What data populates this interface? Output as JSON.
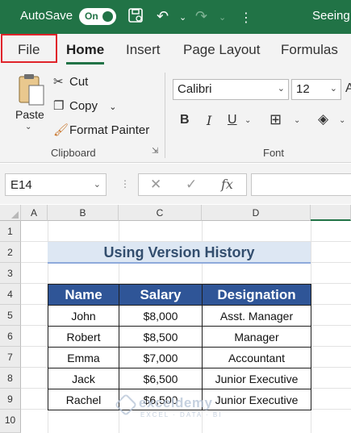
{
  "titlebar": {
    "autosave_label": "AutoSave",
    "autosave_state": "On",
    "document": "Seeing"
  },
  "tabs": [
    "File",
    "Home",
    "Insert",
    "Page Layout",
    "Formulas"
  ],
  "ribbon": {
    "clipboard": {
      "paste": "Paste",
      "cut": "Cut",
      "copy": "Copy",
      "format_painter": "Format Painter",
      "group_label": "Clipboard"
    },
    "font": {
      "font_name": "Calibri",
      "font_size": "12",
      "bold": "B",
      "italic": "I",
      "underline": "U",
      "group_label": "Font"
    }
  },
  "formula_bar": {
    "name_box": "E14",
    "fx": "fx"
  },
  "grid": {
    "columns": [
      "A",
      "B",
      "C",
      "D"
    ],
    "rows": [
      "1",
      "2",
      "3",
      "4",
      "5",
      "6",
      "7",
      "8",
      "9",
      "10"
    ]
  },
  "sheet": {
    "title": "Using Version History",
    "headers": [
      "Name",
      "Salary",
      "Designation"
    ],
    "rows": [
      [
        "John",
        "$8,000",
        "Asst. Manager"
      ],
      [
        "Robert",
        "$8,500",
        "Manager"
      ],
      [
        "Emma",
        "$7,000",
        "Accountant"
      ],
      [
        "Jack",
        "$6,500",
        "Junior Executive"
      ],
      [
        "Rachel",
        "$6,500",
        "Junior Executive"
      ]
    ]
  },
  "watermark": {
    "name": "exceldemy",
    "sub": "EXCEL · DATA · BI"
  },
  "colors": {
    "excel_green": "#217346",
    "header_blue": "#2f5597",
    "title_fill": "#dde7f3",
    "highlight_red": "#e0232a"
  }
}
